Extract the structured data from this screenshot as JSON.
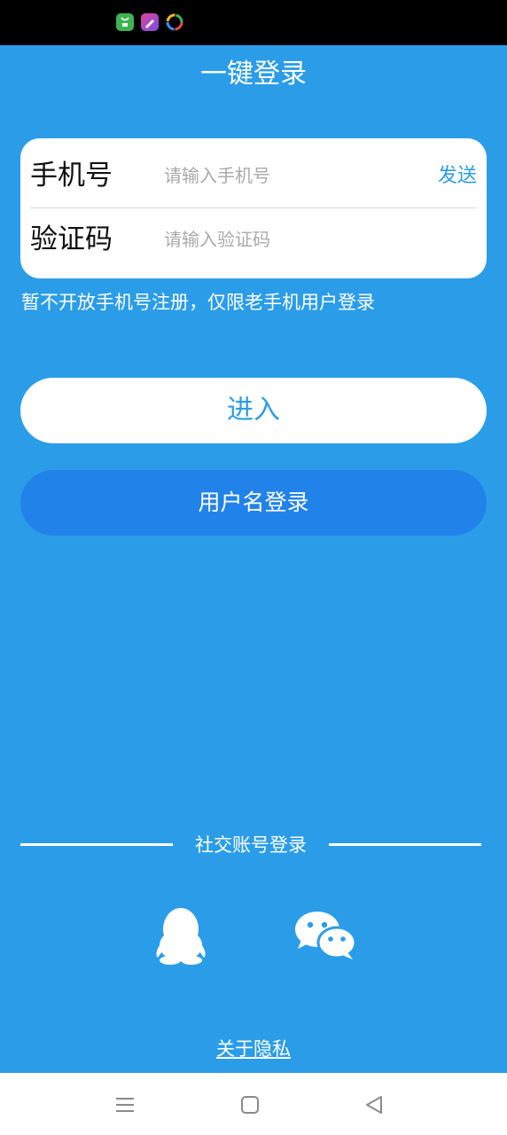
{
  "status_bar": {
    "icons": [
      "store-app-icon",
      "pen-app-icon",
      "browser-app-icon"
    ]
  },
  "header": {
    "title": "一键登录"
  },
  "form": {
    "phone_label": "手机号",
    "phone_placeholder": "请输入手机号",
    "send_label": "发送",
    "code_label": "验证码",
    "code_placeholder": "请输入验证码"
  },
  "notice": "暂不开放手机号注册，仅限老手机用户登录",
  "buttons": {
    "enter": "进入",
    "username_login": "用户名登录"
  },
  "social": {
    "label": "社交账号登录",
    "icons": [
      "qq-icon",
      "wechat-icon"
    ]
  },
  "privacy_link": "关于隐私",
  "colors": {
    "background": "#2b9de8",
    "accent": "#2b9de8",
    "secondary_button": "#2183ea",
    "card": "#ffffff"
  },
  "nav_bar": {
    "icons": [
      "menu-icon",
      "home-icon",
      "back-icon"
    ]
  }
}
